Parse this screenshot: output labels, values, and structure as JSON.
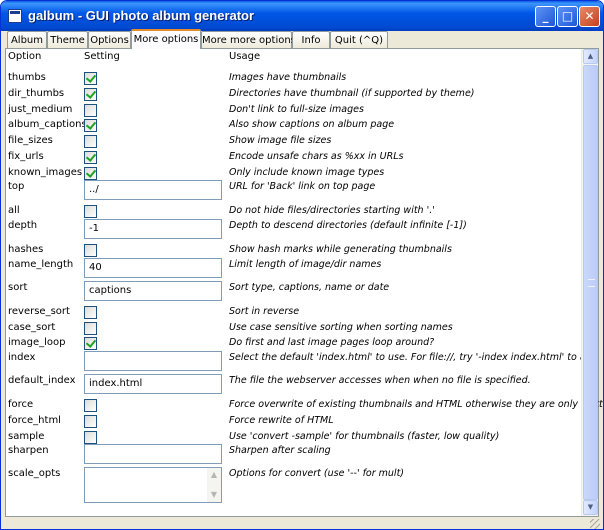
{
  "window": {
    "title": "galbum - GUI photo album generator"
  },
  "titlebar_buttons": {
    "minimize": "_",
    "maximize": "□",
    "close": "✕"
  },
  "tabs": [
    {
      "label": "Album",
      "active": false
    },
    {
      "label": "Theme",
      "active": false
    },
    {
      "label": "Options",
      "active": false
    },
    {
      "label": "More options",
      "active": true
    },
    {
      "label": "More more options",
      "active": false
    },
    {
      "label": "Info",
      "active": false
    },
    {
      "label": "Quit  (^Q)",
      "active": false
    }
  ],
  "headers": {
    "option": "Option",
    "setting": "Setting",
    "usage": "Usage"
  },
  "options": [
    {
      "name": "thumbs",
      "type": "checkbox",
      "checked": true,
      "usage": "Images have thumbnails"
    },
    {
      "name": "dir_thumbs",
      "type": "checkbox",
      "checked": true,
      "usage": "Directories have thumbnail (if supported by theme)"
    },
    {
      "name": "just_medium",
      "type": "checkbox",
      "checked": false,
      "usage": "Don't link to full-size images"
    },
    {
      "name": "album_captions",
      "type": "checkbox",
      "checked": true,
      "usage": "Also show captions on album page"
    },
    {
      "name": "file_sizes",
      "type": "checkbox",
      "checked": false,
      "usage": "Show image file sizes"
    },
    {
      "name": "fix_urls",
      "type": "checkbox",
      "checked": true,
      "usage": "Encode unsafe chars as %xx in URLs"
    },
    {
      "name": "known_images",
      "type": "checkbox",
      "checked": true,
      "usage": "Only include known image types"
    },
    {
      "name": "top",
      "type": "text",
      "value": "../",
      "usage": "URL for 'Back' link on top page"
    },
    {
      "name": "all",
      "type": "checkbox",
      "checked": false,
      "usage": "Do not hide files/directories starting with '.'"
    },
    {
      "name": "depth",
      "type": "text",
      "value": "-1",
      "usage": "Depth to descend directories (default infinite [-1])"
    },
    {
      "name": "hashes",
      "type": "checkbox",
      "checked": false,
      "usage": "Show hash marks while generating thumbnails"
    },
    {
      "name": "name_length",
      "type": "text",
      "value": "40",
      "usage": "Limit length of image/dir names"
    },
    {
      "name": "sort",
      "type": "text",
      "value": "captions",
      "usage": "Sort type, captions, name or date"
    },
    {
      "name": "reverse_sort",
      "type": "checkbox",
      "checked": false,
      "usage": "Sort in reverse"
    },
    {
      "name": "case_sort",
      "type": "checkbox",
      "checked": false,
      "usage": "Use case sensitive sorting when sorting names"
    },
    {
      "name": "image_loop",
      "type": "checkbox",
      "checked": true,
      "usage": "Do first and last image pages loop around?"
    },
    {
      "name": "index",
      "type": "text",
      "value": "",
      "usage": "Select the default 'index.html' to use.  For file://, try '-index index.html' to add"
    },
    {
      "name": "default_index",
      "type": "text",
      "value": "index.html",
      "usage": "The file the webserver accesses when  when no file is specified."
    },
    {
      "name": "force",
      "type": "checkbox",
      "checked": false,
      "usage": "Force overwrite of existing thumbnails and HTML  otherwise they are only writt"
    },
    {
      "name": "force_html",
      "type": "checkbox",
      "checked": false,
      "usage": "Force rewrite of HTML"
    },
    {
      "name": "sample",
      "type": "checkbox",
      "checked": false,
      "usage": "Use 'convert -sample' for thumbnails (faster, low quality)"
    },
    {
      "name": "sharpen",
      "type": "text",
      "value": "",
      "usage": "Sharpen after scaling"
    },
    {
      "name": "scale_opts",
      "type": "textarea",
      "value": "",
      "usage": "Options for convert (use '--' for mult)"
    }
  ],
  "icons": {
    "app": "album-icon",
    "scroll_up": "arrow-up-icon",
    "scroll_down": "arrow-down-icon",
    "resize": "resize-grip-icon"
  },
  "colors": {
    "titlebar": "#0058e6",
    "active_tab_accent": "#e68b2c",
    "checkmark": "#21a121"
  }
}
